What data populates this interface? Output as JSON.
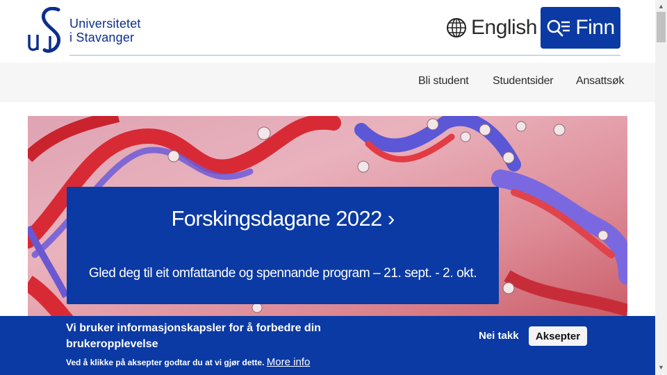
{
  "header": {
    "logo_line1": "Universitetet",
    "logo_line2": "i Stavanger",
    "language_label": "English",
    "find_label": "Finn"
  },
  "nav": {
    "items": [
      {
        "label": "Bli student"
      },
      {
        "label": "Studentsider"
      },
      {
        "label": "Ansattsøk"
      }
    ]
  },
  "hero": {
    "title": "Forskingsdagane 2022 ›",
    "subtitle": "Gled deg til eit omfattande og spennande program – 21. sept. - 2. okt."
  },
  "cookie_banner": {
    "title": "Vi bruker informasjonskapsler for å forbedre din brukeropplevelse",
    "text": "Ved å klikke på aksepter godtar du at vi gjør dette.",
    "more_info": "More info",
    "decline_label": "Nei takk",
    "accept_label": "Aksepter"
  },
  "colors": {
    "brand_blue": "#0b3aa4",
    "nav_background": "#f6f6f6"
  },
  "icons": {
    "language": "globe-icon",
    "find": "search-menu-icon",
    "scroll_up": "arrow-up-icon",
    "scroll_down": "arrow-down-icon"
  }
}
